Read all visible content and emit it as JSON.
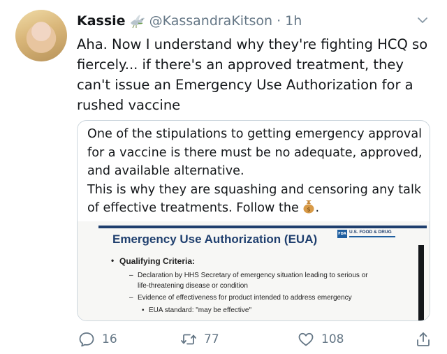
{
  "tweet": {
    "author": {
      "name": "Kassie",
      "badge_icon": "dove-icon",
      "handle": "@KassandraKitson",
      "separator": "·",
      "time": "1h"
    },
    "text": "Aha. Now I understand why they're fighting HCQ so fiercely... if there's an approved treatment, they can't issue an Emergency Use Authorization for a rushed vaccine",
    "quote": {
      "text_main": "One of the stipulations to getting emergency approval for a vaccine is there must be no adequate, approved, and available alternative.",
      "text_second": "This is why they are squashing and censoring any talk of effective treatments. Follow the",
      "text_end": ".",
      "emoji_icon": "money-bag-icon",
      "image": {
        "title": "Emergency Use Authorization (EUA)",
        "logo_text": "U.S. FOOD & DRUG",
        "logo_mark": "FDA",
        "heading": "Qualifying Criteria:",
        "item1_line1": "Declaration by HHS Secretary of emergency situation leading to serious or",
        "item1_line2": "life-threatening disease or condition",
        "item2": "Evidence of effectiveness for product intended to address emergency",
        "subitem": "EUA standard: \"may be effective\""
      }
    },
    "actions": {
      "reply_count": "16",
      "retweet_count": "77",
      "like_count": "108"
    },
    "colors": {
      "text": "#14171a",
      "secondary": "#657786",
      "border": "#ccd6dd",
      "fda_navy": "#1f3f6e"
    }
  }
}
